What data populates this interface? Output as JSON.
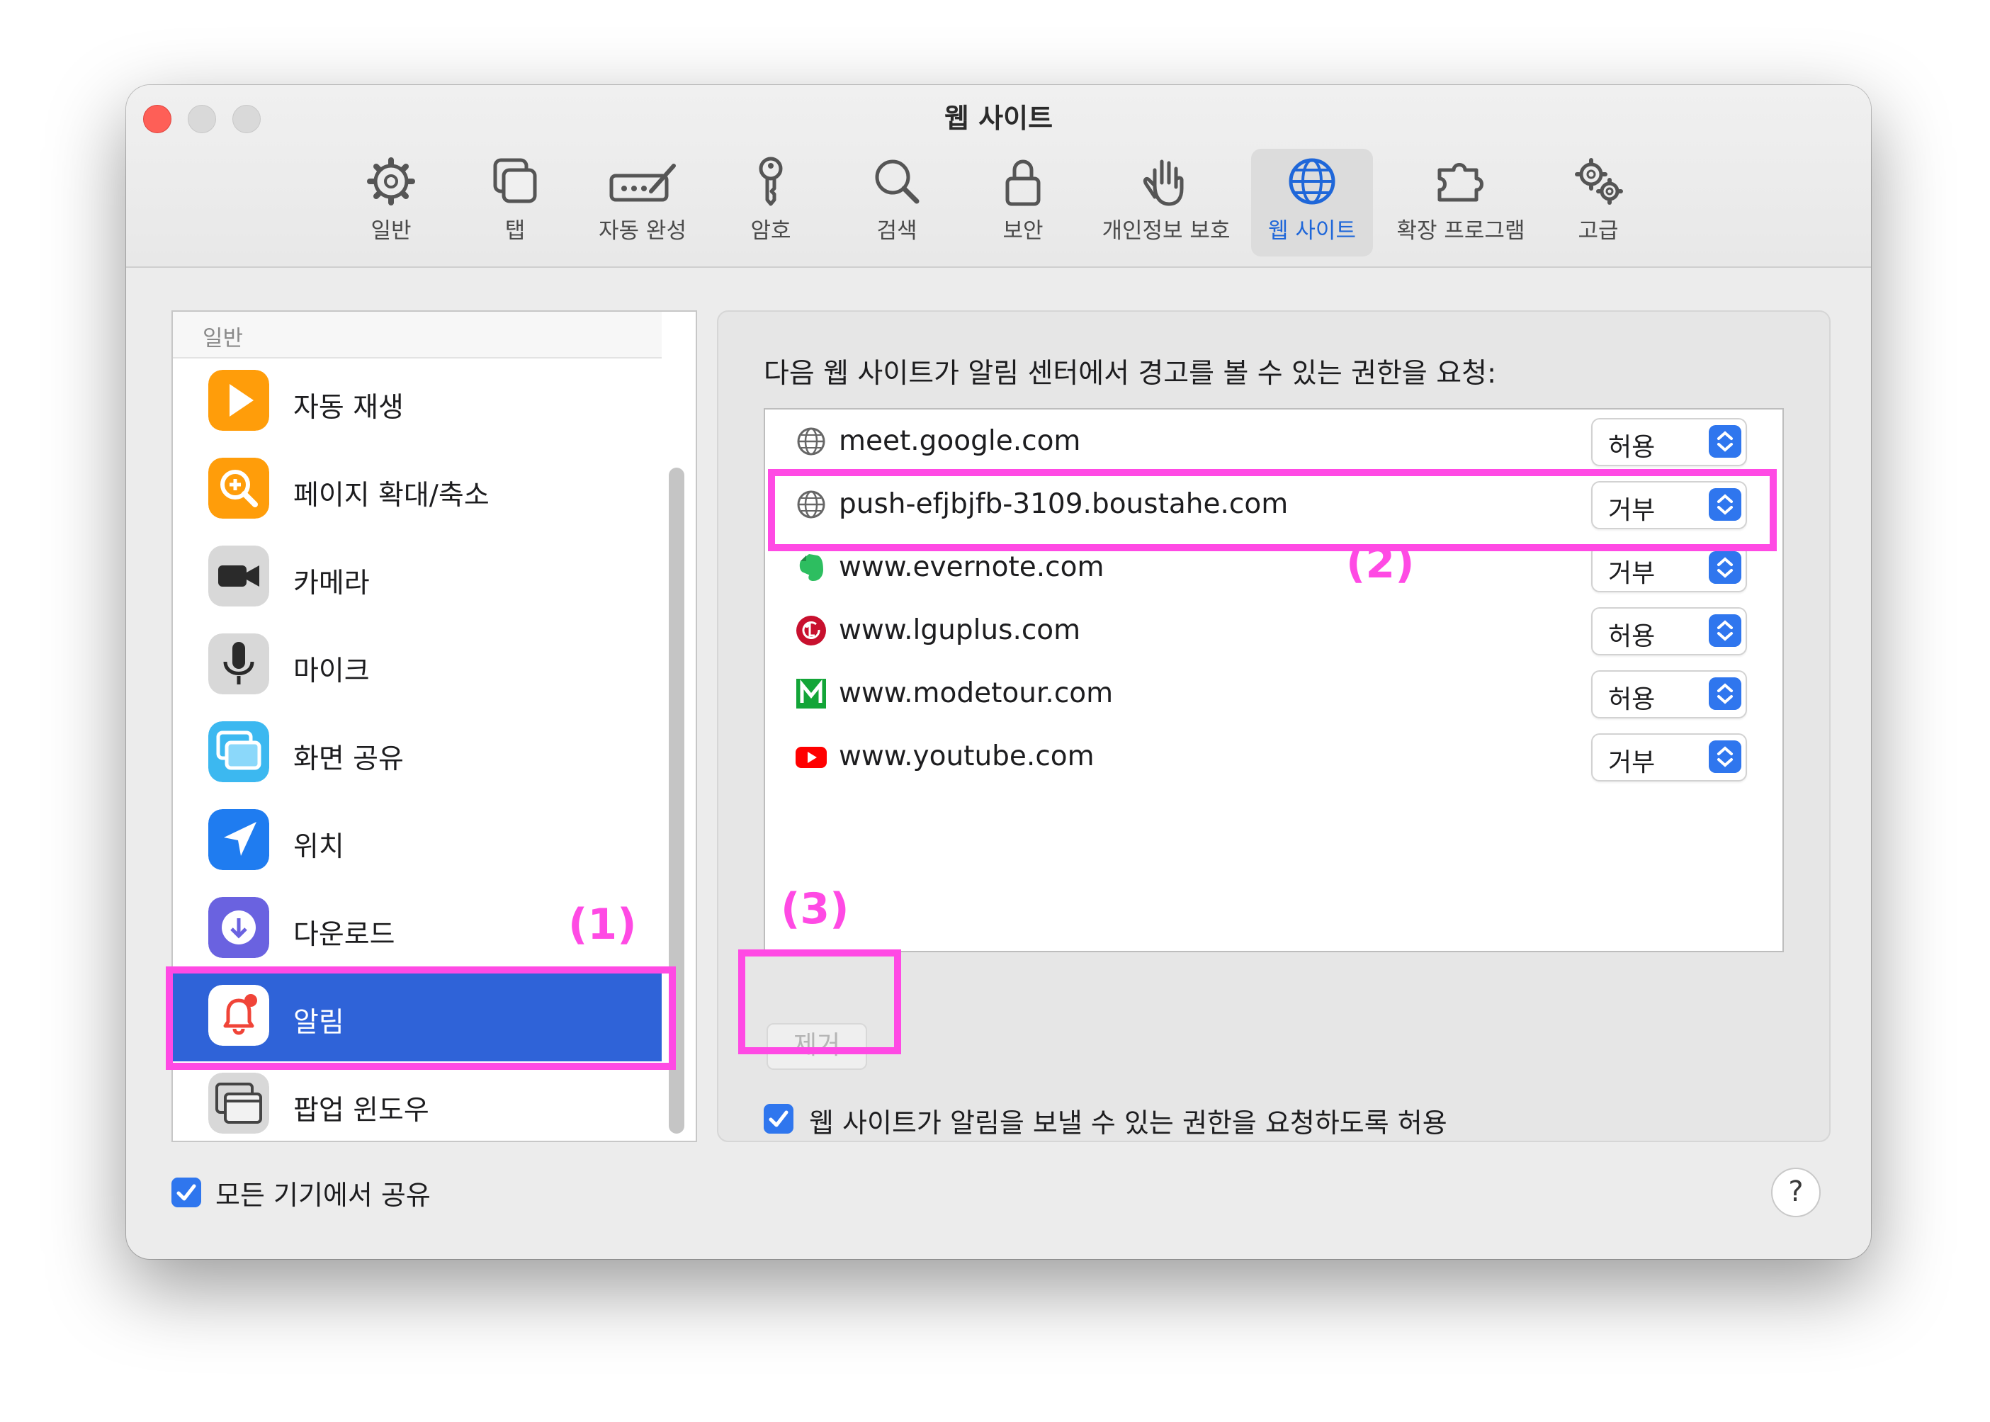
{
  "window": {
    "title": "웹 사이트"
  },
  "toolbar": {
    "items": [
      {
        "label": "일반",
        "icon": "gear-icon"
      },
      {
        "label": "탭",
        "icon": "tabs-icon"
      },
      {
        "label": "자동 완성",
        "icon": "pencil-form-icon"
      },
      {
        "label": "암호",
        "icon": "key-icon"
      },
      {
        "label": "검색",
        "icon": "magnifier-icon"
      },
      {
        "label": "보안",
        "icon": "lock-icon"
      },
      {
        "label": "개인정보 보호",
        "icon": "hand-icon"
      },
      {
        "label": "웹 사이트",
        "icon": "globe-icon",
        "active": true
      },
      {
        "label": "확장 프로그램",
        "icon": "puzzle-icon"
      },
      {
        "label": "고급",
        "icon": "gears-icon"
      }
    ]
  },
  "sidebar": {
    "header": "일반",
    "items": [
      {
        "label": "자동 재생",
        "icon": "play-icon"
      },
      {
        "label": "페이지 확대/축소",
        "icon": "zoom-icon"
      },
      {
        "label": "카메라",
        "icon": "camera-icon"
      },
      {
        "label": "마이크",
        "icon": "microphone-icon"
      },
      {
        "label": "화면 공유",
        "icon": "screen-share-icon"
      },
      {
        "label": "위치",
        "icon": "location-arrow-icon"
      },
      {
        "label": "다운로드",
        "icon": "download-icon"
      },
      {
        "label": "알림",
        "icon": "bell-icon",
        "selected": true
      },
      {
        "label": "팝업 윈도우",
        "icon": "popup-window-icon"
      }
    ]
  },
  "panel": {
    "title": "다음 웹 사이트가 알림 센터에서 경고를 볼 수 있는 권한을 요청:",
    "sites": [
      {
        "name": "meet.google.com",
        "permission": "허용",
        "icon": "globe-icon"
      },
      {
        "name": "push-efjbjfb-3109.boustahe.com",
        "permission": "거부",
        "icon": "globe-icon"
      },
      {
        "name": "www.evernote.com",
        "permission": "거부",
        "icon": "evernote-icon"
      },
      {
        "name": "www.lguplus.com",
        "permission": "허용",
        "icon": "lg-icon"
      },
      {
        "name": "www.modetour.com",
        "permission": "허용",
        "icon": "modetour-icon"
      },
      {
        "name": "www.youtube.com",
        "permission": "거부",
        "icon": "youtube-icon"
      }
    ],
    "remove_button": "제거",
    "allow_checkbox_label": "웹 사이트가 알림을 보낼 수 있는 권한을 요청하도록 허용",
    "allow_checked": true
  },
  "footer": {
    "share_label": "모든 기기에서 공유",
    "share_checked": true,
    "help": "?"
  },
  "annotations": {
    "one": "(1)",
    "two": "(2)",
    "three": "(3)",
    "color": "#ff4ae4"
  },
  "colors": {
    "accent": "#2f76ee",
    "selection": "#2f63d8",
    "close": "#fe5f57"
  }
}
